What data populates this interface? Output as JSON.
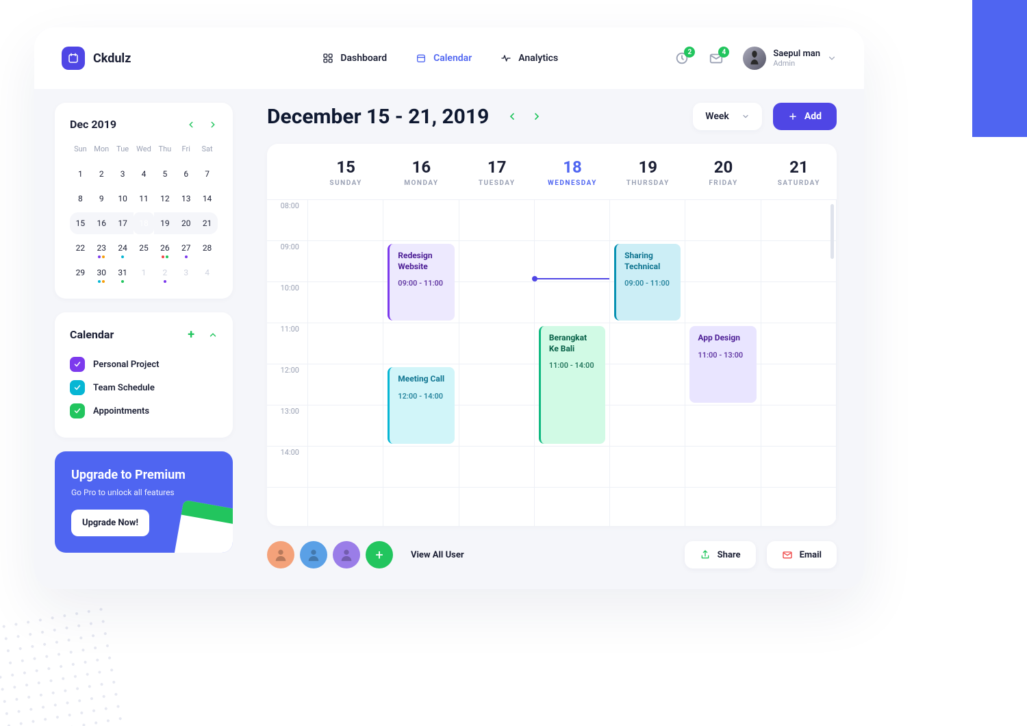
{
  "brand": "Ckdulz",
  "nav": {
    "dashboard": "Dashboard",
    "calendar": "Calendar",
    "analytics": "Analytics"
  },
  "notif": {
    "bell": "2",
    "mail": "4"
  },
  "user": {
    "name": "Saepul man",
    "role": "Admin"
  },
  "mini": {
    "title": "Dec 2019",
    "dow": [
      "Sun",
      "Mon",
      "Tue",
      "Wed",
      "Thu",
      "Fri",
      "Sat"
    ],
    "rows": [
      [
        "1",
        "2",
        "3",
        "4",
        "5",
        "6",
        "7"
      ],
      [
        "8",
        "9",
        "10",
        "11",
        "12",
        "13",
        "14"
      ],
      [
        "15",
        "16",
        "17",
        "18",
        "19",
        "20",
        "21"
      ],
      [
        "22",
        "23",
        "24",
        "25",
        "26",
        "27",
        "28"
      ],
      [
        "29",
        "30",
        "31",
        "1",
        "2",
        "3",
        "4"
      ]
    ],
    "selected": "18",
    "highlightRow": 2,
    "dotDays": {
      "23": [
        "#7c3aed",
        "#f59e0b"
      ],
      "24": [
        "#06b6d4"
      ],
      "26": [
        "#ef4444",
        "#22c55e"
      ],
      "27": [
        "#7c3aed"
      ],
      "30": [
        "#06b6d4",
        "#f59e0b"
      ],
      "31": [
        "#22c55e"
      ],
      "2b": [
        "#7c3aed"
      ]
    }
  },
  "calendars": {
    "title": "Calendar",
    "items": [
      {
        "label": "Personal Project",
        "color": "#7c3aed"
      },
      {
        "label": "Team Schedule",
        "color": "#06b6d4"
      },
      {
        "label": "Appointments",
        "color": "#22c55e"
      }
    ]
  },
  "promo": {
    "title": "Upgrade to Premium",
    "sub": "Go Pro to unlock all features",
    "cta": "Upgrade Now!"
  },
  "main": {
    "range": "December 15 - 21, 2019",
    "viewSelect": "Week",
    "addLabel": "Add",
    "days": [
      {
        "num": "15",
        "name": "SUNDAY"
      },
      {
        "num": "16",
        "name": "MONDAY"
      },
      {
        "num": "17",
        "name": "TUESDAY"
      },
      {
        "num": "18",
        "name": "WEDNESDAY",
        "today": true
      },
      {
        "num": "19",
        "name": "THURSDAY"
      },
      {
        "num": "20",
        "name": "FRIDAY"
      },
      {
        "num": "21",
        "name": "SATURDAY"
      }
    ],
    "hours": [
      "08:00",
      "09:00",
      "10:00",
      "11:00",
      "12:00",
      "13:00",
      "14:00"
    ],
    "events": [
      {
        "col": 1,
        "startH": 9,
        "endH": 11,
        "cls": "purple",
        "title": "Redesign Website",
        "time": "09:00 - 11:00"
      },
      {
        "col": 1,
        "startH": 12,
        "endH": 14,
        "cls": "cyan",
        "title": "Meeting Call",
        "time": "12:00 - 14:00"
      },
      {
        "col": 3,
        "startH": 11,
        "endH": 14,
        "cls": "green",
        "title": "Berangkat Ke Bali",
        "time": "11:00 - 14:00"
      },
      {
        "col": 4,
        "startH": 9,
        "endH": 11,
        "cls": "cyan-dark",
        "title": "Sharing Technical",
        "time": "09:00 - 11:00"
      },
      {
        "col": 5,
        "startH": 11,
        "endH": 13,
        "cls": "purple-sat",
        "title": "App Design",
        "time": "11:00 - 13:00"
      }
    ],
    "nowLine": {
      "col": 3,
      "hour": 9.9
    }
  },
  "footer": {
    "viewAll": "View All User",
    "share": "Share",
    "email": "Email"
  },
  "avatarColors": [
    "#f4a27a",
    "#5aa0e6",
    "#9a7de8"
  ]
}
